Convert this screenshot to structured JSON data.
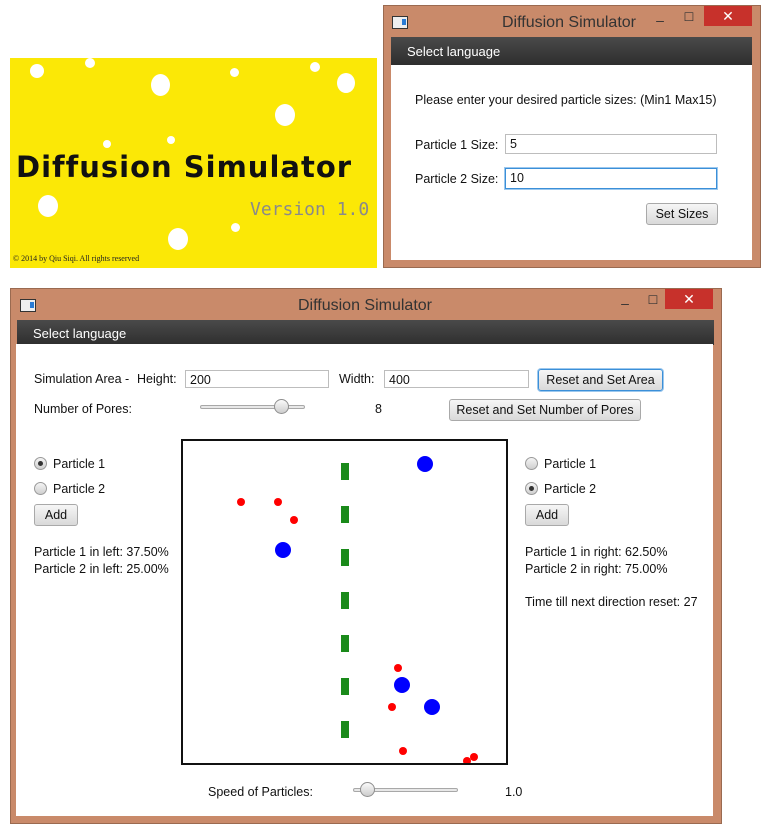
{
  "splash": {
    "title": "Diffusion Simulator",
    "version": "Version 1.0",
    "copyright": "© 2014 by Qiu Siqi. All rights reserved",
    "background_color": "#fbe806"
  },
  "size_dialog": {
    "window_title": "Diffusion Simulator",
    "menu": "Select language",
    "prompt": "Please enter your desired particle sizes: (Min1 Max15)",
    "particle1_label": "Particle 1 Size:",
    "particle1_value": "5",
    "particle2_label": "Particle 2 Size:",
    "particle2_value": "10",
    "set_button": "Set Sizes",
    "minimize_icon": "–",
    "maximize_icon": "☐",
    "close_icon": "✕"
  },
  "main": {
    "window_title": "Diffusion Simulator",
    "menu": "Select language",
    "area_label": "Simulation Area -",
    "height_label": "Height:",
    "height_value": "200",
    "width_label": "Width:",
    "width_value": "400",
    "reset_area_button": "Reset and Set Area",
    "pores_label": "Number of Pores:",
    "pores_value": "8",
    "pores_slider_fraction": 0.82,
    "reset_pores_button": "Reset and Set Number of Pores",
    "left_panel": {
      "radio1": "Particle 1",
      "radio2": "Particle 2",
      "selected": "Particle 1",
      "add_button": "Add",
      "stat1": "Particle 1 in left: 37.50%",
      "stat2": "Particle 2 in left: 25.00%"
    },
    "right_panel": {
      "radio1": "Particle 1",
      "radio2": "Particle 2",
      "selected": "Particle 2",
      "add_button": "Add",
      "stat1": "Particle 1 in right: 62.50%",
      "stat2": "Particle 2 in right: 75.00%",
      "timer": "Time till next direction reset: 27"
    },
    "speed_label": "Speed of Particles:",
    "speed_value": "1.0",
    "speed_slider_fraction": 0.08,
    "colors": {
      "particle1": "#ff0000",
      "particle2": "#0000ff",
      "pore": "#1a8a1a",
      "frame": "#c98a6a",
      "close": "#c7312b"
    }
  }
}
